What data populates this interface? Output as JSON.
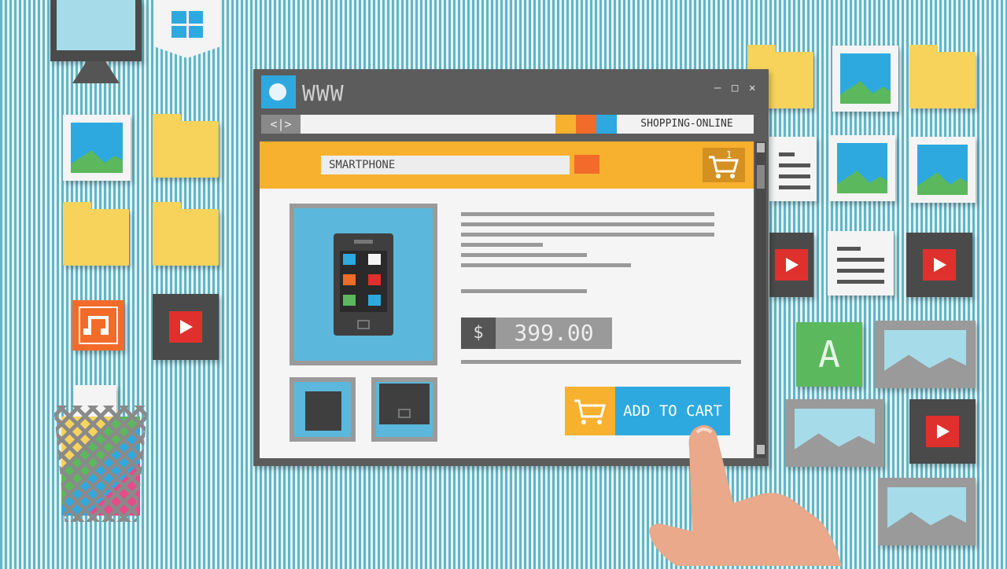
{
  "window": {
    "title": "WWW",
    "url": "SHOPPING-ONLINE",
    "nav": "<|>",
    "controls": [
      "–",
      "□",
      "✕"
    ]
  },
  "shop": {
    "search_value": "SMARTPHONE",
    "cart_count": "1",
    "price_symbol": "$",
    "price": "399.00",
    "add_to_cart": "ADD TO CART"
  },
  "desktop": {
    "icons": [
      "monitor-icon",
      "windows-icon",
      "folder-icon",
      "image-icon",
      "music-icon",
      "video-icon",
      "trash-icon",
      "document-icon",
      "font-icon"
    ],
    "font_letter": "A"
  },
  "colors": {
    "accent_orange": "#f8b12e",
    "accent_blue": "#2ea9e0",
    "window_gray": "#5c5c5c",
    "search_button": "#f26b2a"
  }
}
